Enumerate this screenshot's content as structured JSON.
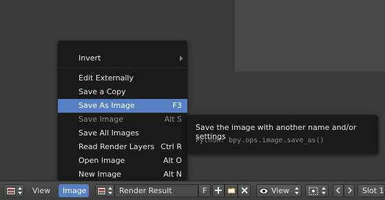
{
  "menu": {
    "items": [
      {
        "label": "Invert",
        "shortcut": "",
        "submenu": true,
        "state": "normal"
      },
      {
        "label": "Edit Externally",
        "shortcut": "",
        "state": "normal"
      },
      {
        "label": "Save a Copy",
        "shortcut": "",
        "state": "normal"
      },
      {
        "label": "Save As Image",
        "shortcut": "F3",
        "state": "highlighted"
      },
      {
        "label": "Save Image",
        "shortcut": "Alt S",
        "state": "disabled"
      },
      {
        "label": "Save All Images",
        "shortcut": "",
        "state": "normal"
      },
      {
        "label": "Read Render Layers",
        "shortcut": "Ctrl R",
        "state": "normal"
      },
      {
        "label": "Open Image",
        "shortcut": "Alt O",
        "state": "normal"
      },
      {
        "label": "New Image",
        "shortcut": "Alt N",
        "state": "normal"
      }
    ]
  },
  "tooltip": {
    "title": "Save the image with another name and/or settings",
    "python": "Python: bpy.ops.image.save_as()"
  },
  "header": {
    "view_menu": "View",
    "image_menu": "Image",
    "image_name": "Render Result",
    "fake_user": "F",
    "view_mode": "View",
    "slot": "Slot 1"
  },
  "colors": {
    "highlight": "#5680c2",
    "menu_bg": "#191919"
  }
}
